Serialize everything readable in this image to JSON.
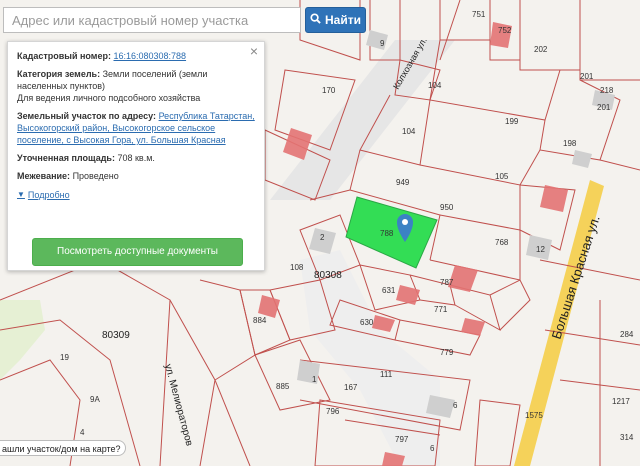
{
  "search": {
    "placeholder": "Адрес или кадастровый номер участка",
    "button_label": "Найти"
  },
  "card": {
    "cadastral_label": "Кадастровый номер:",
    "cadastral_value": "16:16:080308:788",
    "category_label": "Категория земель:",
    "category_value": "Земли поселений (земли населенных пунктов)",
    "usage_value": "Для ведения личного подсобного хозяйства",
    "address_label": "Земельный участок по адресу:",
    "address_value": "Республика Татарстан, Высокогорский район, Высокогорское сельское поселение, с Высокая Гора, ул. Большая Красная",
    "area_label": "Уточненная площадь:",
    "area_value": "708 кв.м.",
    "survey_label": "Межевание:",
    "survey_value": "Проведено",
    "more_label": "Подробно",
    "docs_button": "Посмотреть доступные документы",
    "close_glyph": "×"
  },
  "bottom_hint": "ашли участок/дом на карте?",
  "map": {
    "quarters": [
      "80308",
      "80309"
    ],
    "streets": [
      "Колхозная ул.",
      "Большая Красная ул.",
      "ул. Мелиораторов"
    ],
    "selected_parcel": "788",
    "parcel_labels": [
      "751",
      "752",
      "9",
      "202",
      "170",
      "104",
      "199",
      "201",
      "218",
      "104",
      "198",
      "949",
      "105",
      "950",
      "788",
      "768",
      "12",
      "2",
      "108",
      "130",
      "631",
      "665",
      "787",
      "474",
      "884",
      "630",
      "663",
      "771",
      "780",
      "778",
      "779",
      "111",
      "885",
      "1",
      "167",
      "796",
      "6",
      "797",
      "6",
      "1575",
      "1217",
      "284",
      "314",
      "19",
      "9A",
      "4",
      "3",
      "24",
      "3A",
      "5",
      "1",
      "201",
      "1064",
      "628",
      "473",
      "9A"
    ],
    "colors": {
      "parcel_line": "#c0504d",
      "selected_fill": "#33dd55",
      "building": "#e37373",
      "road": "#f5d25a",
      "marker": "#3b82c4"
    }
  }
}
